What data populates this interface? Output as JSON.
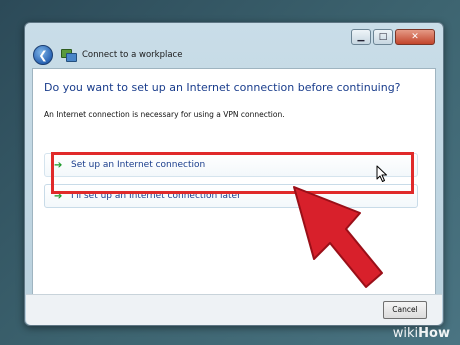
{
  "window": {
    "caption_buttons": {
      "minimize": "▁",
      "maximize": "□",
      "close": "✕"
    },
    "nav": {
      "back_icon": "back-arrow-icon",
      "title": "Connect to a workplace"
    }
  },
  "content": {
    "heading": "Do you want to set up an Internet connection before continuing?",
    "subtext": "An Internet connection is necessary for using a VPN connection.",
    "options": [
      {
        "arrow": "➔",
        "label": "Set up an Internet connection"
      },
      {
        "arrow": "➔",
        "label": "I'll set up an Internet connection later"
      }
    ]
  },
  "footer": {
    "cancel_label": "Cancel"
  },
  "annotation": {
    "highlight_color": "#e02a2a"
  },
  "watermark": {
    "wiki": "wiki",
    "how": "How"
  }
}
